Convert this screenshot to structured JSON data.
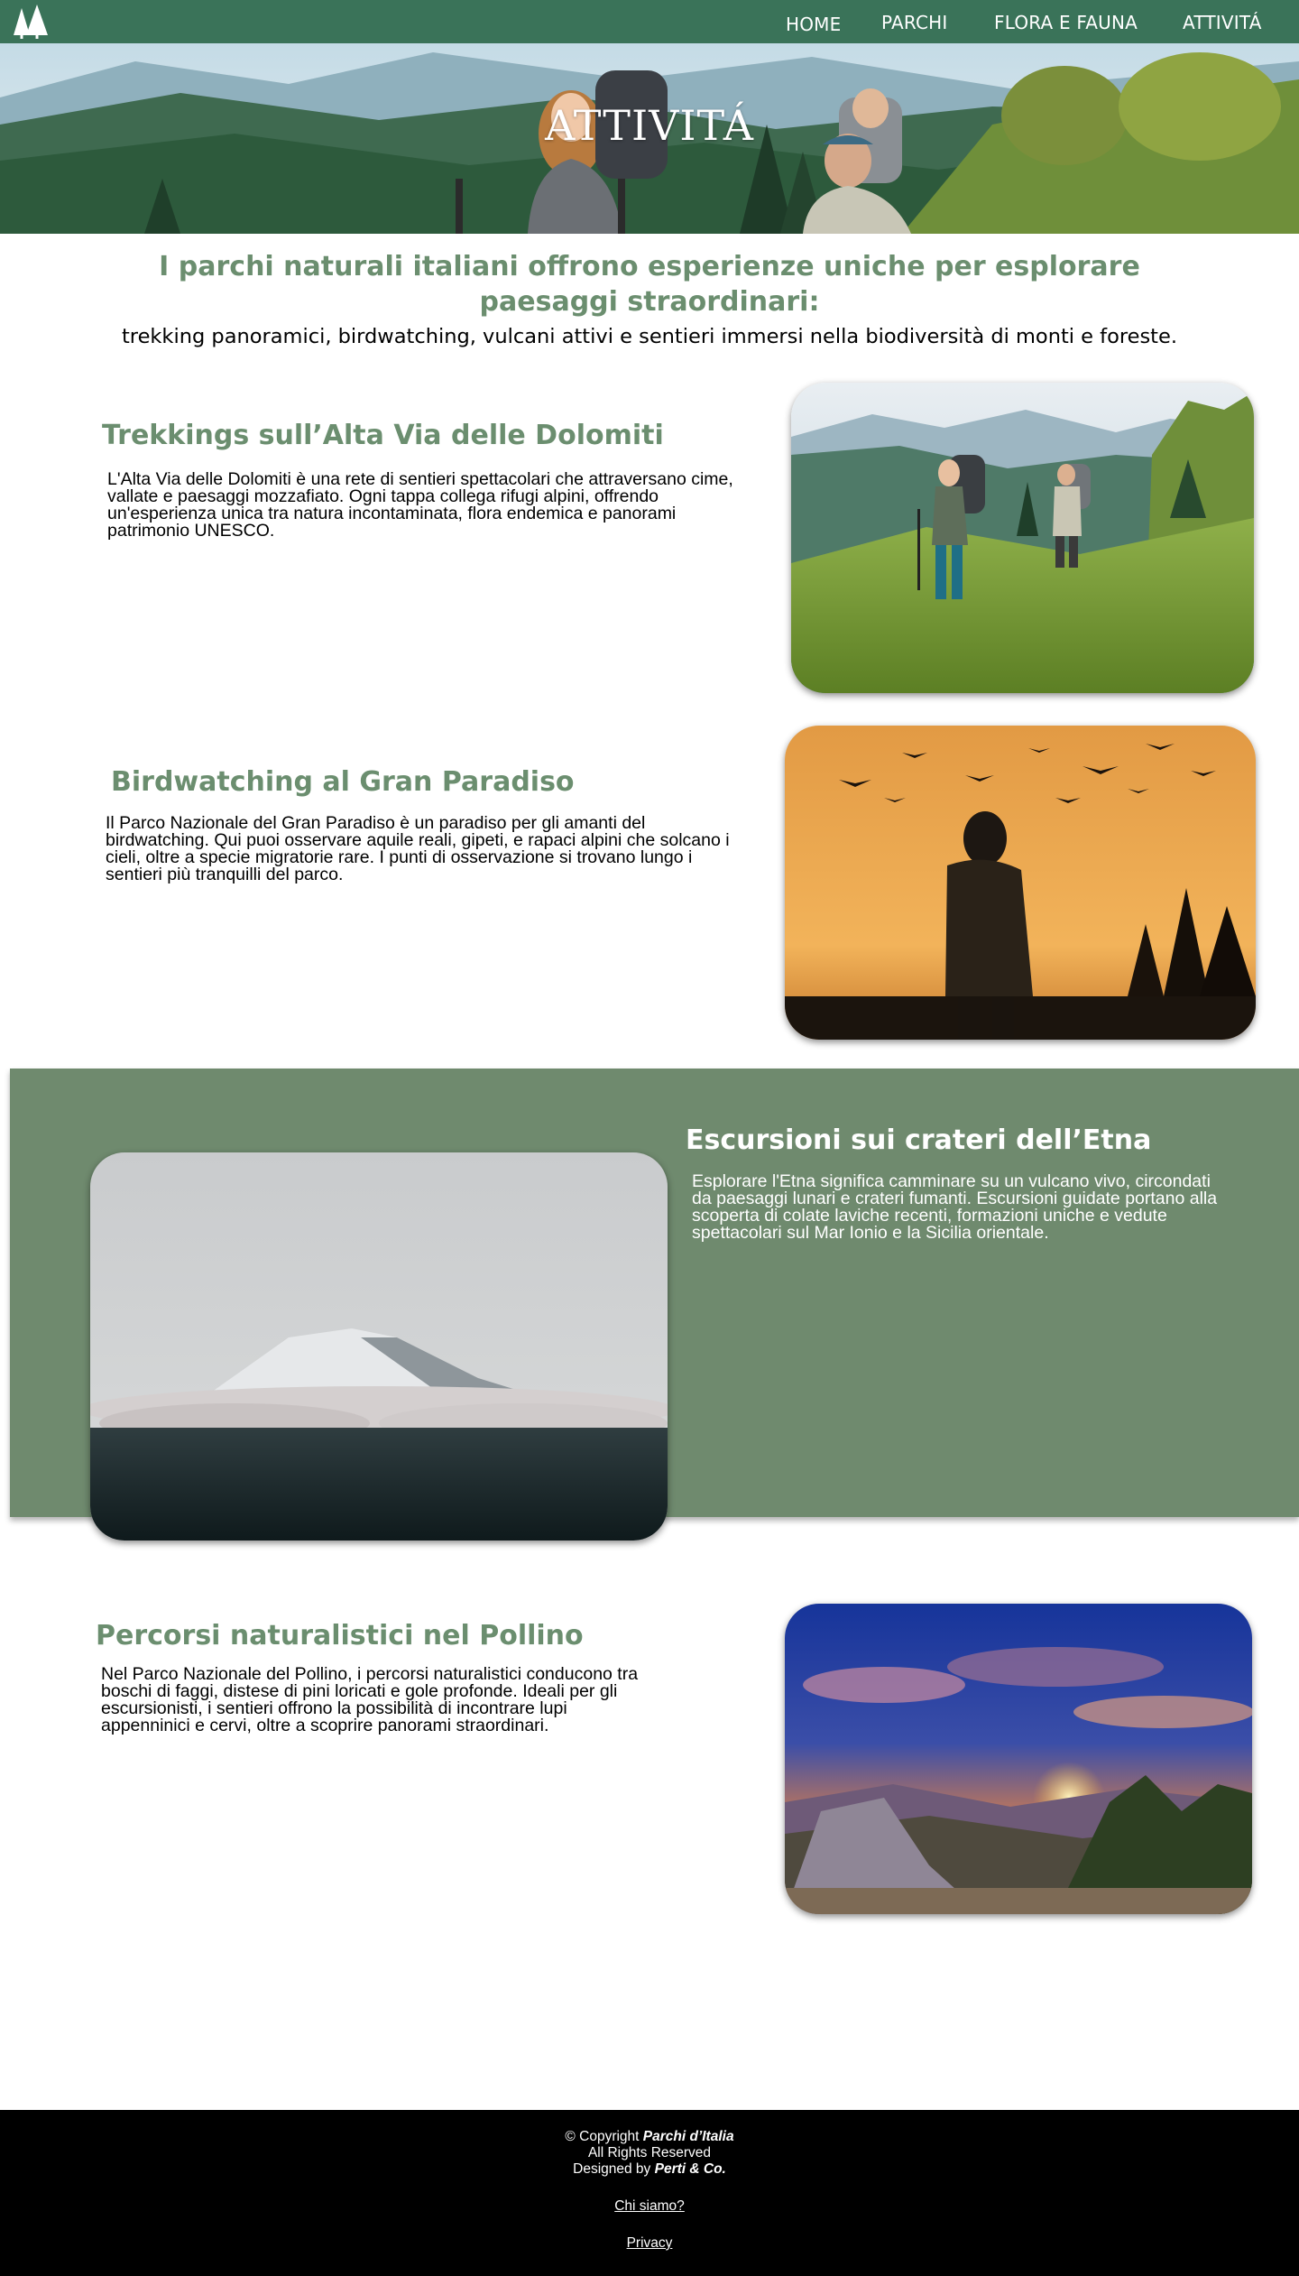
{
  "nav": {
    "logo_icon": "pine-trees-icon",
    "items": [
      "HOME",
      "PARCHI",
      "FLORA E FAUNA",
      "ATTIVITÁ"
    ]
  },
  "hero": {
    "title": "ATTIVITÁ"
  },
  "intro": {
    "heading": "I parchi naturali italiani offrono esperienze uniche per esplorare paesaggi straordinari:",
    "subheading": "trekking panoramici, birdwatching, vulcani attivi e sentieri immersi nella biodiversità di monti e foreste."
  },
  "sections": [
    {
      "title": "Trekkings sull’Alta Via delle Dolomiti",
      "text": "L'Alta Via delle Dolomiti è una rete di sentieri spettacolari che attraversano cime, vallate e paesaggi mozzafiato. Ogni tappa collega rifugi alpini, offrendo un'esperienza unica tra natura incontaminata, flora endemica e panorami patrimonio UNESCO.",
      "image": "hikers-in-mountain-meadow"
    },
    {
      "title": "Birdwatching al Gran Paradiso",
      "text": "Il Parco Nazionale del Gran Paradiso è un paradiso per gli amanti del birdwatching. Qui puoi osservare aquile reali, gipeti, e rapaci alpini che solcano i cieli, oltre a specie migratorie rare. I punti di osservazione si trovano lungo i sentieri più tranquilli del parco.",
      "image": "birdwatcher-at-sunset"
    },
    {
      "title": "Escursioni sui crateri dell’Etna",
      "text": "Esplorare l'Etna significa camminare su un vulcano vivo, circondati da paesaggi lunari e crateri fumanti. Escursioni guidate portano alla scoperta di colate laviche recenti, formazioni uniche e vedute spettacolari sul Mar Ionio e la Sicilia orientale.",
      "image": "snowy-etna-above-clouds"
    },
    {
      "title": "Percorsi naturalistici nel Pollino",
      "text": "Nel Parco Nazionale del Pollino, i percorsi naturalistici conducono tra boschi di faggi, distese di pini loricati e gole profonde. Ideali per gli escursionisti, i sentieri offrono la possibilità di incontrare lupi appenninici e cervi, oltre a scoprire panorami straordinari.",
      "image": "pollino-sunset-landscape"
    }
  ],
  "colors": {
    "nav_bg": "#3a7359",
    "accent_text": "#6b8e6f",
    "band_bg": "#6f8a6e",
    "footer_bg": "#000000"
  },
  "footer": {
    "copyright_prefix": "© Copyright ",
    "copyright_name": "Parchi d’Italia",
    "rights": "All Rights Reserved",
    "designed_prefix": "Designed by ",
    "designer": "Perti & Co.",
    "links": [
      "Chi siamo?",
      "Privacy"
    ]
  }
}
